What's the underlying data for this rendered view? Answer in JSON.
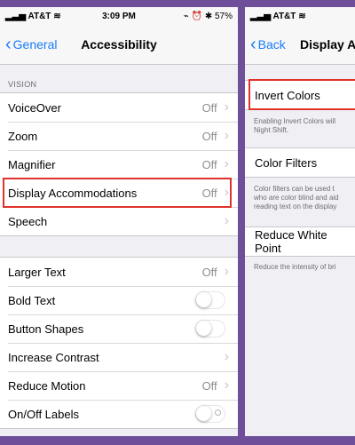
{
  "left": {
    "status": {
      "carrier": "AT&T",
      "time": "3:09 PM",
      "right": "⌁ ⏰ ✱ 57%"
    },
    "nav": {
      "back": "General",
      "title": "Accessibility"
    },
    "vision_label": "VISION",
    "vision_rows": [
      {
        "label": "VoiceOver",
        "value": "Off"
      },
      {
        "label": "Zoom",
        "value": "Off"
      },
      {
        "label": "Magnifier",
        "value": "Off"
      },
      {
        "label": "Display Accommodations",
        "value": "Off"
      },
      {
        "label": "Speech",
        "value": ""
      }
    ],
    "interaction_rows": [
      {
        "label": "Larger Text",
        "value": "Off"
      },
      {
        "label": "Bold Text"
      },
      {
        "label": "Button Shapes"
      },
      {
        "label": "Increase Contrast"
      },
      {
        "label": "Reduce Motion",
        "value": "Off"
      },
      {
        "label": "On/Off Labels"
      }
    ]
  },
  "right": {
    "status": {
      "carrier": "AT&T"
    },
    "nav": {
      "back": "Back",
      "title": "Display Acc"
    },
    "invert_colors": {
      "label": "Invert Colors",
      "footer": [
        "Enabling Invert Colors will",
        "Night Shift."
      ]
    },
    "color_filters": {
      "label": "Color Filters",
      "footer": [
        "Color filters can be used t",
        "who are color blind and aid",
        "reading text on the display"
      ]
    },
    "reduce_white_point": {
      "label": "Reduce White Point",
      "footer": [
        "Reduce the intensity of bri"
      ]
    }
  },
  "colors": {
    "accent": "#1a7dfa",
    "highlight": "#e0332b",
    "frame": "#6f4f9a"
  }
}
